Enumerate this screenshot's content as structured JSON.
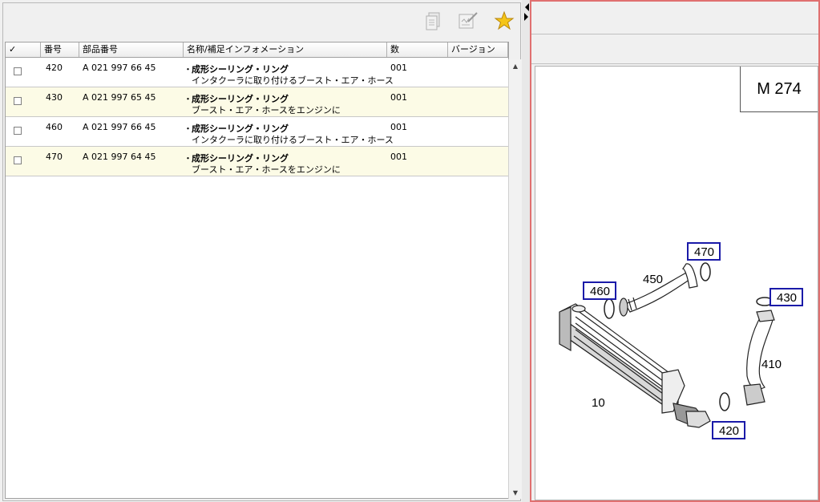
{
  "toolbar": {
    "icons": [
      "print-icon",
      "edit-note-icon",
      "favorite-star-icon"
    ]
  },
  "table": {
    "headers": {
      "check": "✓",
      "no": "番号",
      "part_no": "部品番号",
      "name": "名称/補足インフォメーション",
      "qty": "数",
      "version": "バージョン"
    },
    "rows": [
      {
        "no": "420",
        "part_no": "A 021 997 66 45",
        "bullet": "・",
        "name": "成形シーリング・リング",
        "info": "インタクーラに取り付けるブースト・エア・ホース",
        "qty": "001",
        "version": ""
      },
      {
        "no": "430",
        "part_no": "A 021 997 65 45",
        "bullet": "・",
        "name": "成形シーリング・リング",
        "info": "ブースト・エア・ホースをエンジンに",
        "qty": "001",
        "version": ""
      },
      {
        "no": "460",
        "part_no": "A 021 997 66 45",
        "bullet": "・",
        "name": "成形シーリング・リング",
        "info": "インタクーラに取り付けるブースト・エア・ホース",
        "qty": "001",
        "version": ""
      },
      {
        "no": "470",
        "part_no": "A 021 997 64 45",
        "bullet": "・",
        "name": "成形シーリング・リング",
        "info": "ブースト・エア・ホースをエンジンに",
        "qty": "001",
        "version": ""
      }
    ]
  },
  "diagram": {
    "model": "M 274",
    "labels": {
      "c470": "470",
      "c460": "460",
      "c430": "430",
      "c420": "420",
      "p450": "450",
      "p410": "410",
      "p10": "10"
    },
    "callout_color": "#1a1aa8"
  }
}
